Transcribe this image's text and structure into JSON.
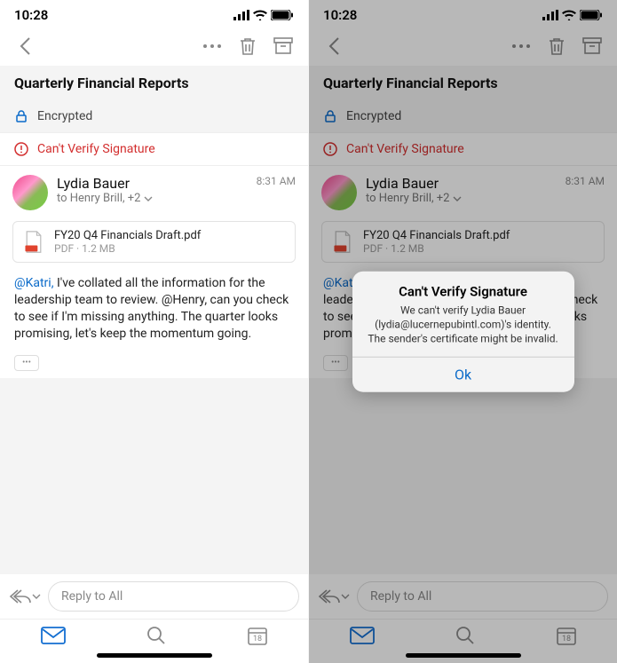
{
  "status": {
    "time": "10:28"
  },
  "subject": "Quarterly Financial Reports",
  "banners": {
    "encrypted": "Encrypted",
    "error": "Can't Verify Signature"
  },
  "message": {
    "from": "Lydia Bauer",
    "to_line": "to Henry Brill, +2",
    "time": "8:31 AM",
    "attachment": {
      "name": "FY20 Q4 Financials Draft.pdf",
      "meta": "PDF · 1.2 MB"
    },
    "mention1": "@Katri,",
    "body_after1": " I've collated all the information for the leadership team to review. @Henry, can you check to see if I'm missing anything. The quarter looks promising, let's keep the momentum going.",
    "body_truncated": " I've collated all the information for the leadership team to review. @Henry, can you check to see if I'm missing anything. The quarter looks promising, let's keep the momentum going."
  },
  "reply": {
    "placeholder": "Reply to All"
  },
  "calendar_day": "18",
  "alert": {
    "title": "Can't Verify Signature",
    "message": "We can't verify Lydia Bauer (lydia@lucernepubintl.com)'s identity. The sender's certificate might be invalid.",
    "ok": "Ok"
  }
}
